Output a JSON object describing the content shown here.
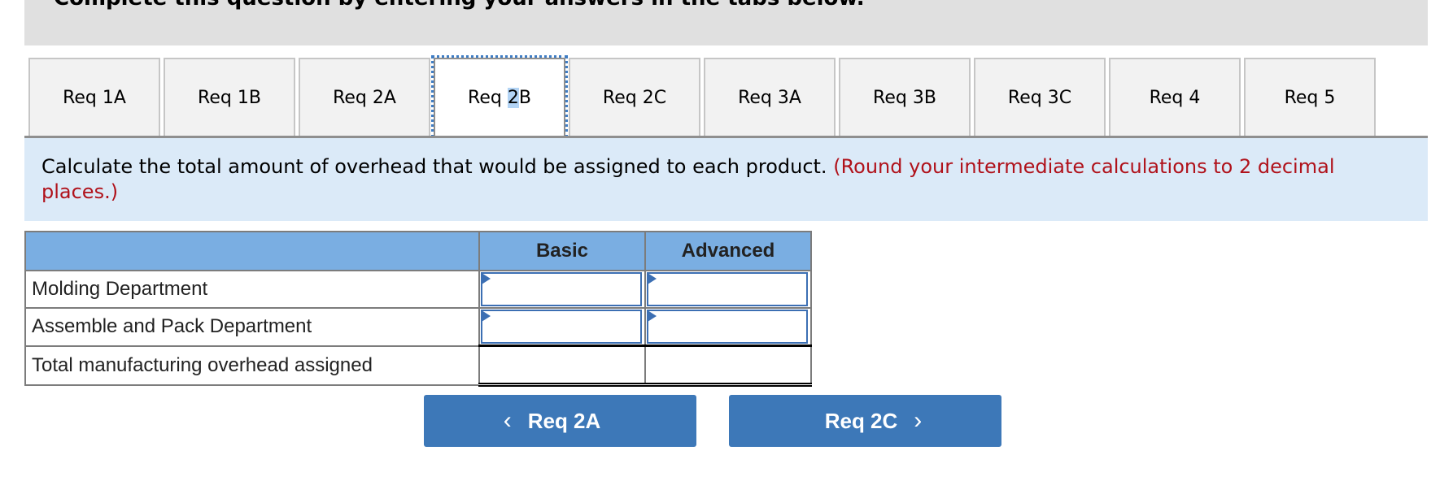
{
  "header": {
    "instruction": "Complete this question by entering your answers in the tabs below."
  },
  "tabs": [
    {
      "label": "Req 1A",
      "active": false
    },
    {
      "label": "Req 1B",
      "active": false
    },
    {
      "label": "Req 2A",
      "active": false
    },
    {
      "label_prefix": "Req ",
      "label_selected": "2",
      "label_suffix": "B",
      "label": "Req 2B",
      "active": true
    },
    {
      "label": "Req 2C",
      "active": false
    },
    {
      "label": "Req 3A",
      "active": false
    },
    {
      "label": "Req 3B",
      "active": false
    },
    {
      "label": "Req 3C",
      "active": false
    },
    {
      "label": "Req 4",
      "active": false
    },
    {
      "label": "Req 5",
      "active": false
    }
  ],
  "question": {
    "text": "Calculate the total amount of overhead that would be assigned to each product.",
    "note": "(Round your intermediate calculations to 2 decimal places.)"
  },
  "table": {
    "columns": [
      "",
      "Basic",
      "Advanced"
    ],
    "rows": [
      {
        "label": "Molding Department",
        "basic": "",
        "advanced": ""
      },
      {
        "label": "Assemble and Pack Department",
        "basic": "",
        "advanced": ""
      },
      {
        "label": "Total manufacturing overhead assigned",
        "basic": "",
        "advanced": ""
      }
    ]
  },
  "nav": {
    "prev_label": "Req 2A",
    "next_label": "Req 2C",
    "prev_icon": "chevron-left-icon",
    "next_icon": "chevron-right-icon"
  },
  "colors": {
    "accent": "#3d78b8",
    "header_bg": "#7aaee2",
    "panel_bg": "#dbeaf8",
    "note_red": "#b0121b"
  }
}
